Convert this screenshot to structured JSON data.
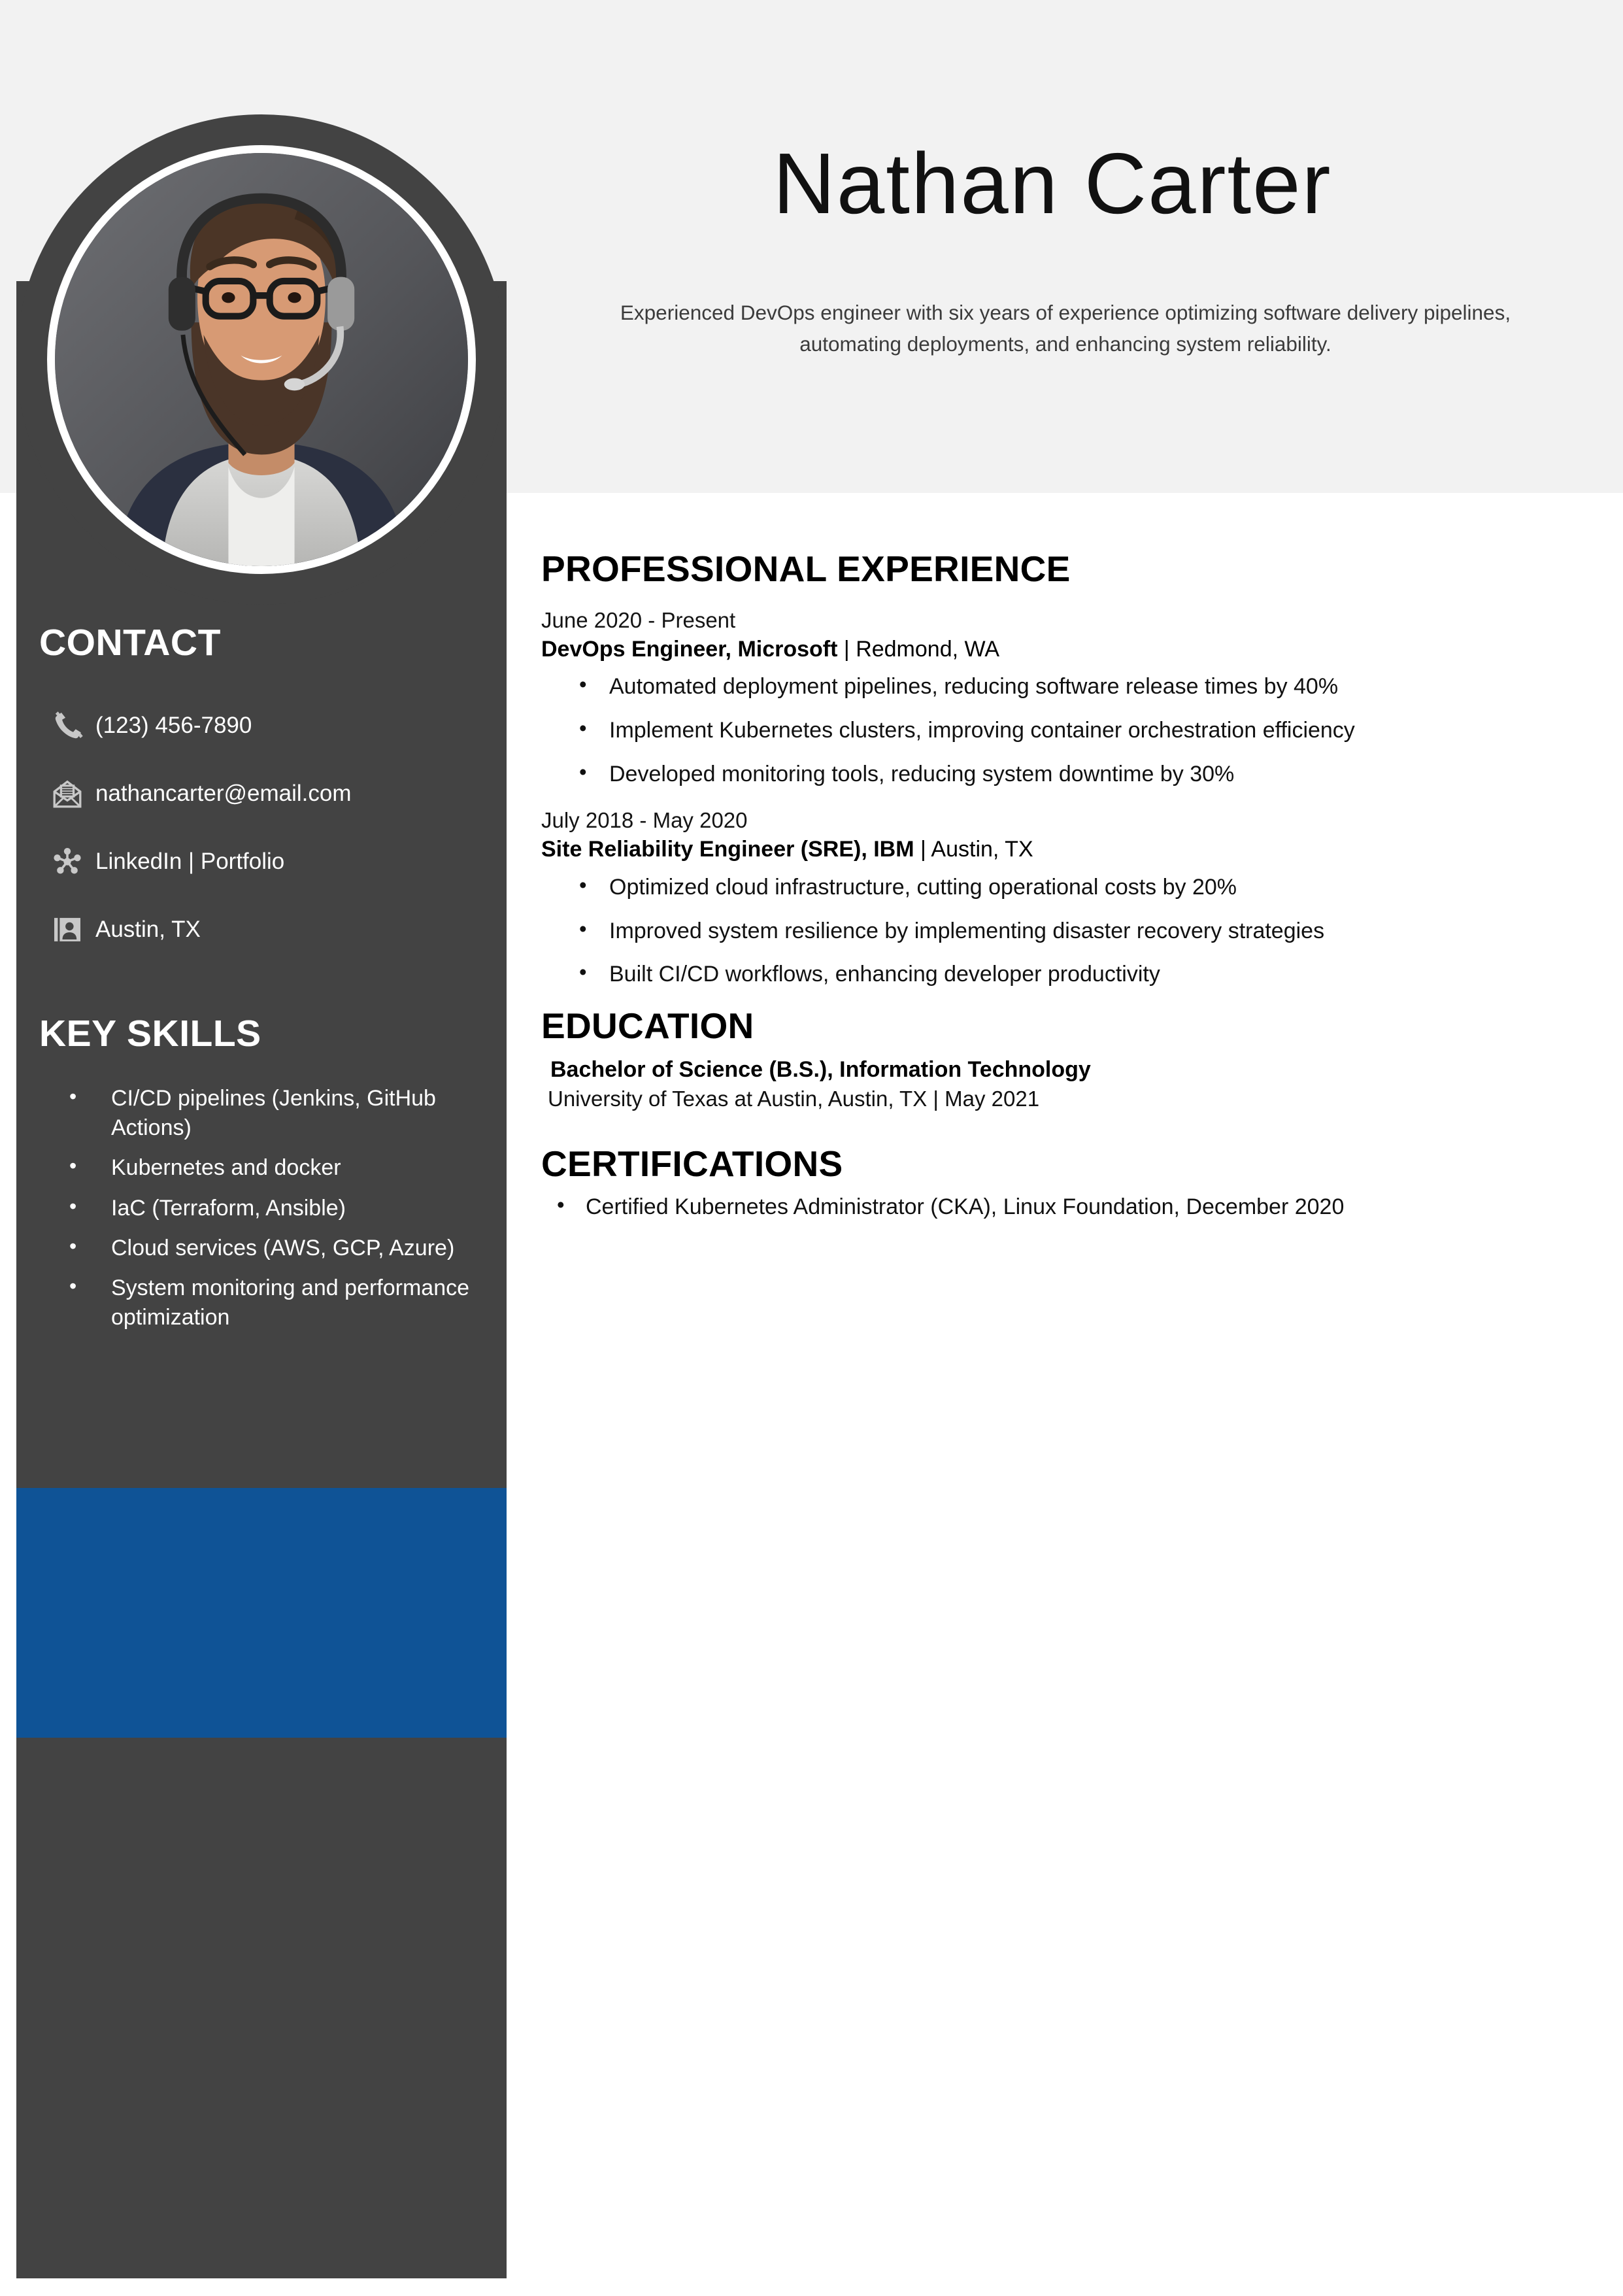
{
  "document": {
    "type": "resume",
    "theme": {
      "sidebar_color": "#434343",
      "accent_color": "#0f5396",
      "header_band_color": "#f2f2f2",
      "page_color": "#ffffff",
      "text_color": "#111111",
      "sidebar_text_color": "#ffffff",
      "icon_color": "#c8c8c8"
    }
  },
  "header": {
    "name": "Nathan Carter",
    "summary": "Experienced DevOps engineer with six years of experience optimizing software delivery pipelines, automating deployments, and enhancing system reliability.",
    "avatar_alt": "Portrait of a bearded man with glasses wearing a headset"
  },
  "sidebar": {
    "contact": {
      "heading": "CONTACT",
      "items": [
        {
          "icon": "phone-icon",
          "text": "(123) 456-7890"
        },
        {
          "icon": "email-icon",
          "text": "nathancarter@email.com"
        },
        {
          "icon": "network-icon",
          "text": "LinkedIn | Portfolio"
        },
        {
          "icon": "contact-card-icon",
          "text": "Austin, TX"
        }
      ]
    },
    "skills": {
      "heading": "KEY SKILLS",
      "items": [
        "CI/CD pipelines (Jenkins, GitHub Actions)",
        "Kubernetes and docker",
        "IaC (Terraform, Ansible)",
        "Cloud services (AWS, GCP, Azure)",
        "System monitoring and performance optimization"
      ]
    }
  },
  "main": {
    "experience": {
      "heading": "PROFESSIONAL EXPERIENCE",
      "jobs": [
        {
          "dates": "June 2020 - Present",
          "title": "DevOps Engineer, Microsoft",
          "separator": " | ",
          "location": "Redmond, WA",
          "bullets": [
            "Automated deployment pipelines, reducing software release times by 40%",
            "Implement Kubernetes clusters, improving container orchestration efficiency",
            "Developed monitoring tools, reducing system downtime by 30%"
          ]
        },
        {
          "dates": "July 2018 - May 2020",
          "title": "Site Reliability Engineer (SRE), IBM",
          "separator": " | ",
          "location": "Austin, TX",
          "bullets": [
            "Optimized cloud infrastructure, cutting operational costs by 20%",
            "Improved system resilience by implementing disaster recovery strategies",
            "Built CI/CD workflows, enhancing developer productivity"
          ]
        }
      ]
    },
    "education": {
      "heading": "EDUCATION",
      "degree": "Bachelor of Science (B.S.), Information Technology",
      "school": "University of Texas at Austin, Austin, TX | May 2021"
    },
    "certifications": {
      "heading": "CERTIFICATIONS",
      "items": [
        "Certified Kubernetes Administrator (CKA), Linux Foundation, December 2020"
      ]
    }
  }
}
